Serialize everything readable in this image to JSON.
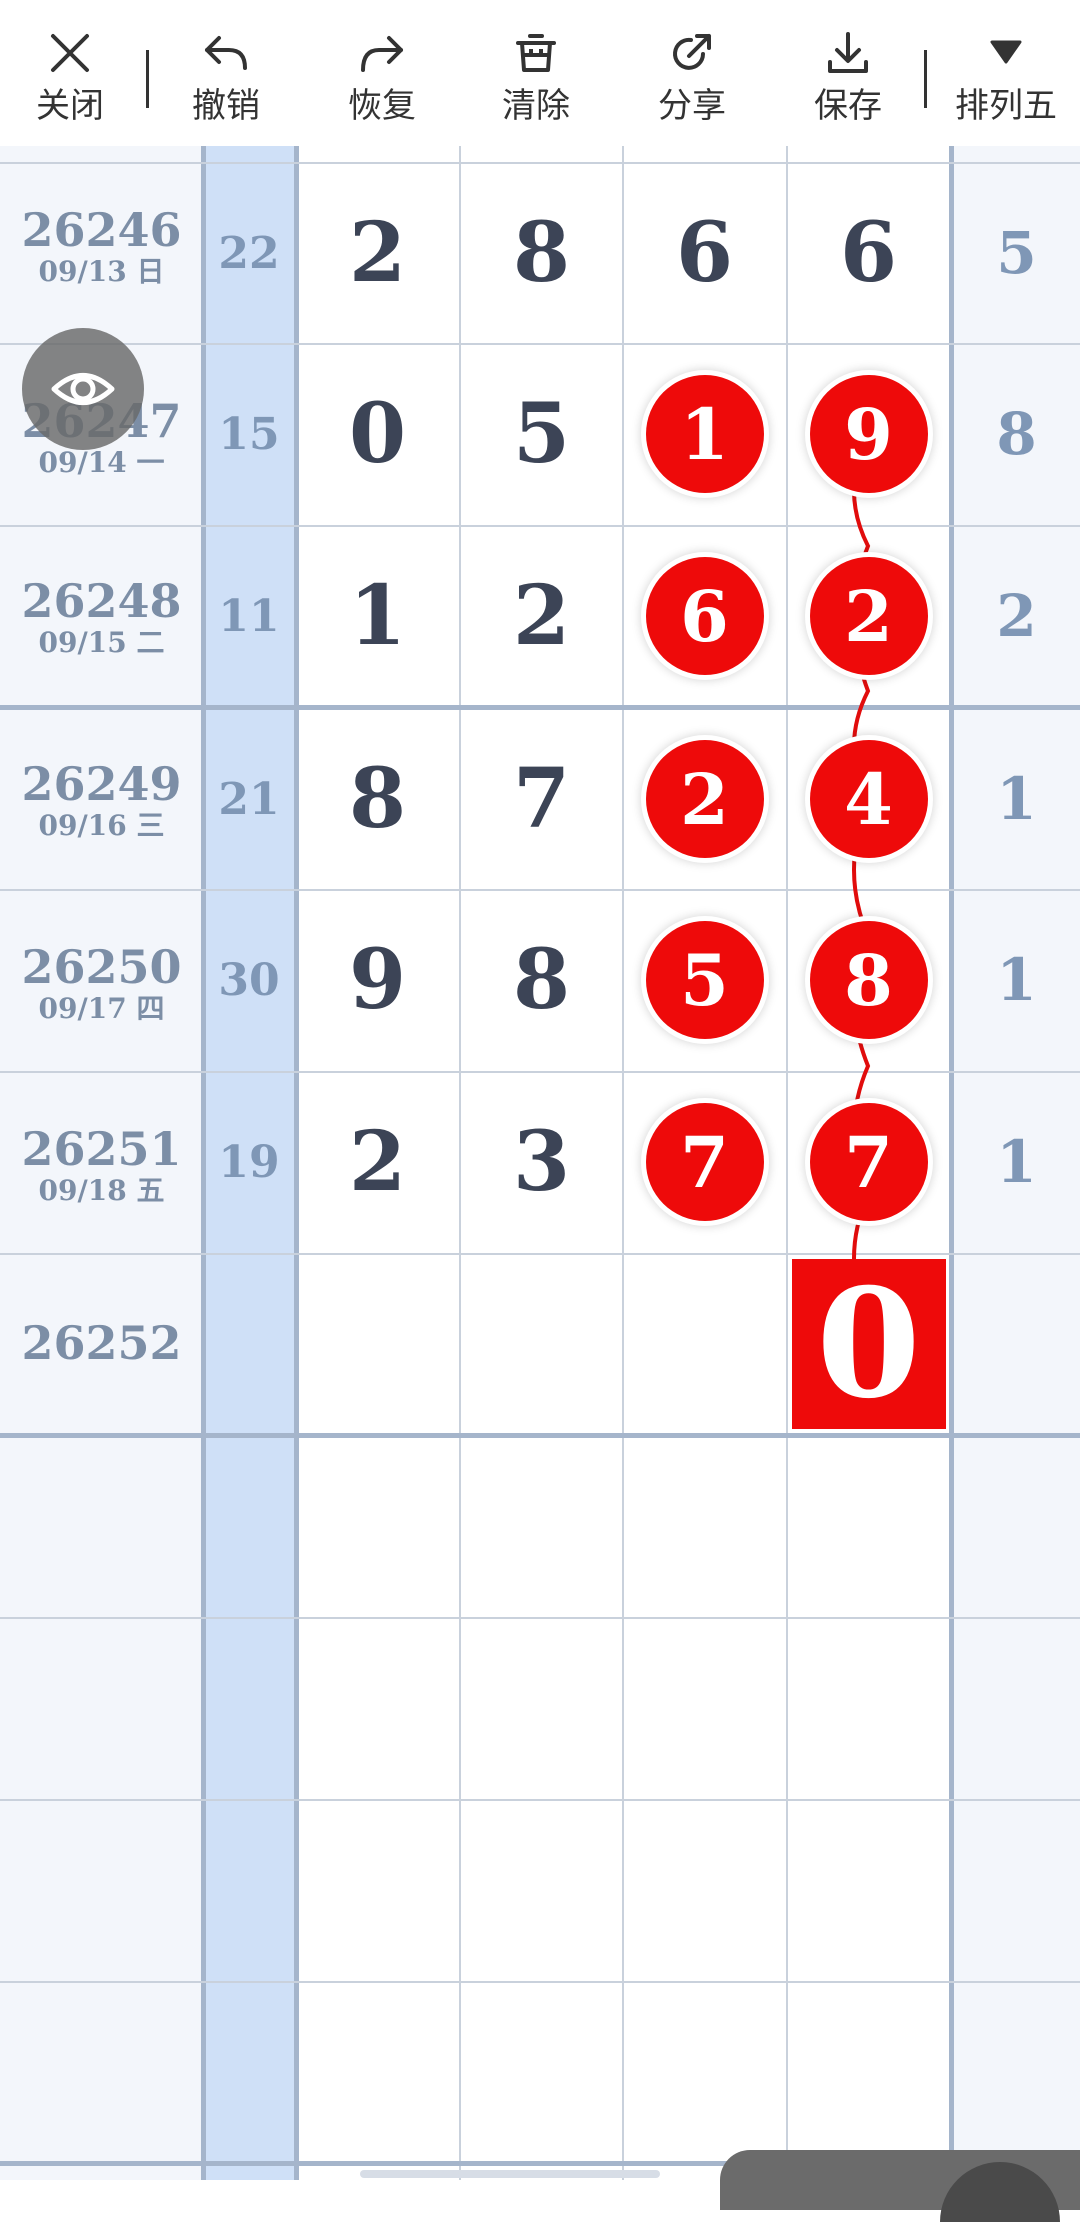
{
  "toolbar": {
    "buttons": [
      {
        "label": "关闭",
        "icon": "close-icon"
      },
      {
        "label": "撤销",
        "icon": "undo-icon"
      },
      {
        "label": "恢复",
        "icon": "redo-icon"
      },
      {
        "label": "清除",
        "icon": "trash-icon"
      },
      {
        "label": "分享",
        "icon": "share-icon"
      },
      {
        "label": "保存",
        "icon": "download-icon"
      },
      {
        "label": "排列五",
        "icon": "triangle-down-icon"
      }
    ]
  },
  "rows": [
    {
      "issue": "26246",
      "date": "09/13 日",
      "sum": "22",
      "d1": "2",
      "d2": "8",
      "d3": "6",
      "d4": "6",
      "extra": "5",
      "d3_marked": false,
      "d4_marked": false
    },
    {
      "issue": "26247",
      "date": "09/14 一",
      "sum": "15",
      "d1": "0",
      "d2": "5",
      "d3": "1",
      "d4": "9",
      "extra": "8",
      "d3_marked": true,
      "d4_marked": true
    },
    {
      "issue": "26248",
      "date": "09/15 二",
      "sum": "11",
      "d1": "1",
      "d2": "2",
      "d3": "6",
      "d4": "2",
      "extra": "2",
      "d3_marked": true,
      "d4_marked": true
    },
    {
      "issue": "26249",
      "date": "09/16 三",
      "sum": "21",
      "d1": "8",
      "d2": "7",
      "d3": "2",
      "d4": "4",
      "extra": "1",
      "d3_marked": true,
      "d4_marked": true
    },
    {
      "issue": "26250",
      "date": "09/17 四",
      "sum": "30",
      "d1": "9",
      "d2": "8",
      "d3": "5",
      "d4": "8",
      "extra": "1",
      "d3_marked": true,
      "d4_marked": true
    },
    {
      "issue": "26251",
      "date": "09/18 五",
      "sum": "19",
      "d1": "2",
      "d2": "3",
      "d3": "7",
      "d4": "7",
      "extra": "1",
      "d3_marked": true,
      "d4_marked": true
    },
    {
      "issue": "26252",
      "pending_d4": "0"
    }
  ],
  "colors": {
    "ball": "#ee0a0a",
    "sum_column": "#cfe0f7",
    "side_column": "#f3f6fb",
    "digit_text": "#3c4456",
    "muted_text": "#7c8ea6"
  },
  "overlay": {
    "icon": "eye-icon"
  }
}
